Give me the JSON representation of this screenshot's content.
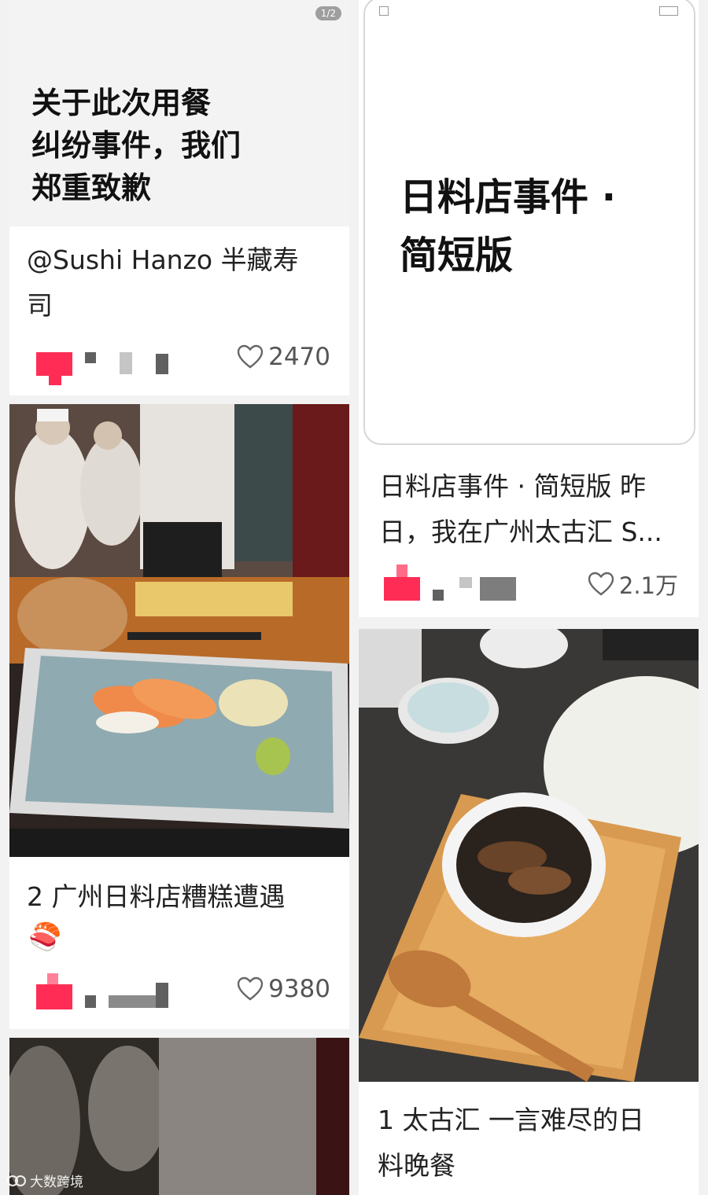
{
  "cards": [
    {
      "cover_text": "关于此次用餐\n纠纷事件，我们\n郑重致歉",
      "page_indicator": "1/2",
      "title": "@Sushi Hanzo 半藏寿\n司",
      "likes": "2470"
    },
    {
      "cover_text": "日料店事件 ·\n简短版",
      "title": "日料店事件 · 简短版 昨\n日，我在广州太古汇 S...",
      "likes": "2.1万"
    },
    {
      "title": "2 广州日料店糟糕遭遇",
      "emoji": "🍣",
      "likes": "9380"
    },
    {
      "title": "1 太古汇 一言难尽的日\n料晚餐"
    }
  ],
  "icons": {
    "like": "heart-outline-icon",
    "watermark": "watermark-logo-icon"
  },
  "watermark": "大数跨境",
  "colors": {
    "avatar": "#ff2d55",
    "background": "#f2f2f2"
  }
}
